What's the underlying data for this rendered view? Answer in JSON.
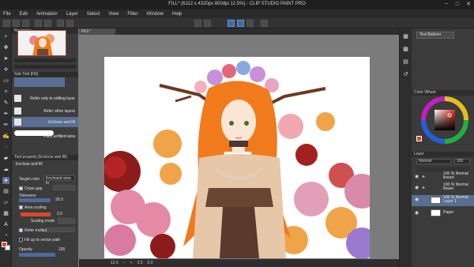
{
  "window": {
    "title": "FILL* (6112 x 4320px 800dpi 12.5%) - CLIP STUDIO PAINT PRO",
    "controls": [
      "−",
      "□",
      "✕"
    ]
  },
  "menu": [
    "File",
    "Edit",
    "Animation",
    "Layer",
    "Select",
    "View",
    "Filter",
    "Window",
    "Help"
  ],
  "canvas_tab": {
    "label": "FILL*"
  },
  "panels": {
    "navigator": {
      "title": "Navigator"
    },
    "subtool": {
      "title": "Sub Tool [Fill]",
      "items": [
        {
          "label": "Refer only to editing layer",
          "selected": false
        },
        {
          "label": "Refer other layers",
          "selected": false
        },
        {
          "label": "Enclose and fill",
          "selected": true
        },
        {
          "label": "Paint unfilled area",
          "selected": false
        }
      ]
    },
    "toolprop": {
      "title": "Tool property [Enclose and fill]",
      "tool_name": "Enclose and fill",
      "target_color_label": "Target color",
      "target_color_value": "Enclosed area in",
      "close_gap_label": "Close gap",
      "tolerance_label": "Tolerance",
      "tolerance_value": "30.0",
      "area_scaling_label": "Area scaling",
      "area_scaling_value": "2.0",
      "scaling_mode_label": "Scaling mode",
      "refer_multiple_label": "Refer multiple",
      "fill_vector_label": "Fill up to vector path",
      "opacity_label": "Opacity",
      "opacity_value": "100"
    },
    "color_wheel": {
      "title": "Color Wheel"
    },
    "layer": {
      "title": "Layer",
      "blend_mode": "Normal",
      "opacity": "100",
      "layers": [
        {
          "name": "Normal",
          "opacity": "100 %",
          "detail": "lineart",
          "selected": false
        },
        {
          "name": "Normal",
          "opacity": "100 %",
          "detail": "flower",
          "selected": false
        },
        {
          "name": "Normal",
          "opacity": "100 %",
          "detail": "Layer 1",
          "selected": true
        },
        {
          "name": "Paper",
          "opacity": "",
          "detail": "",
          "selected": false
        }
      ]
    },
    "top_right_tab": "Text Balloon"
  },
  "status": {
    "zoom": "12.5",
    "angle": "0.0",
    "value": "2.5"
  },
  "colors": {
    "accent": "#5a6e93",
    "main_color": "#d9482b",
    "sub_color": "#ffffff",
    "hair": "#f07a1c"
  }
}
